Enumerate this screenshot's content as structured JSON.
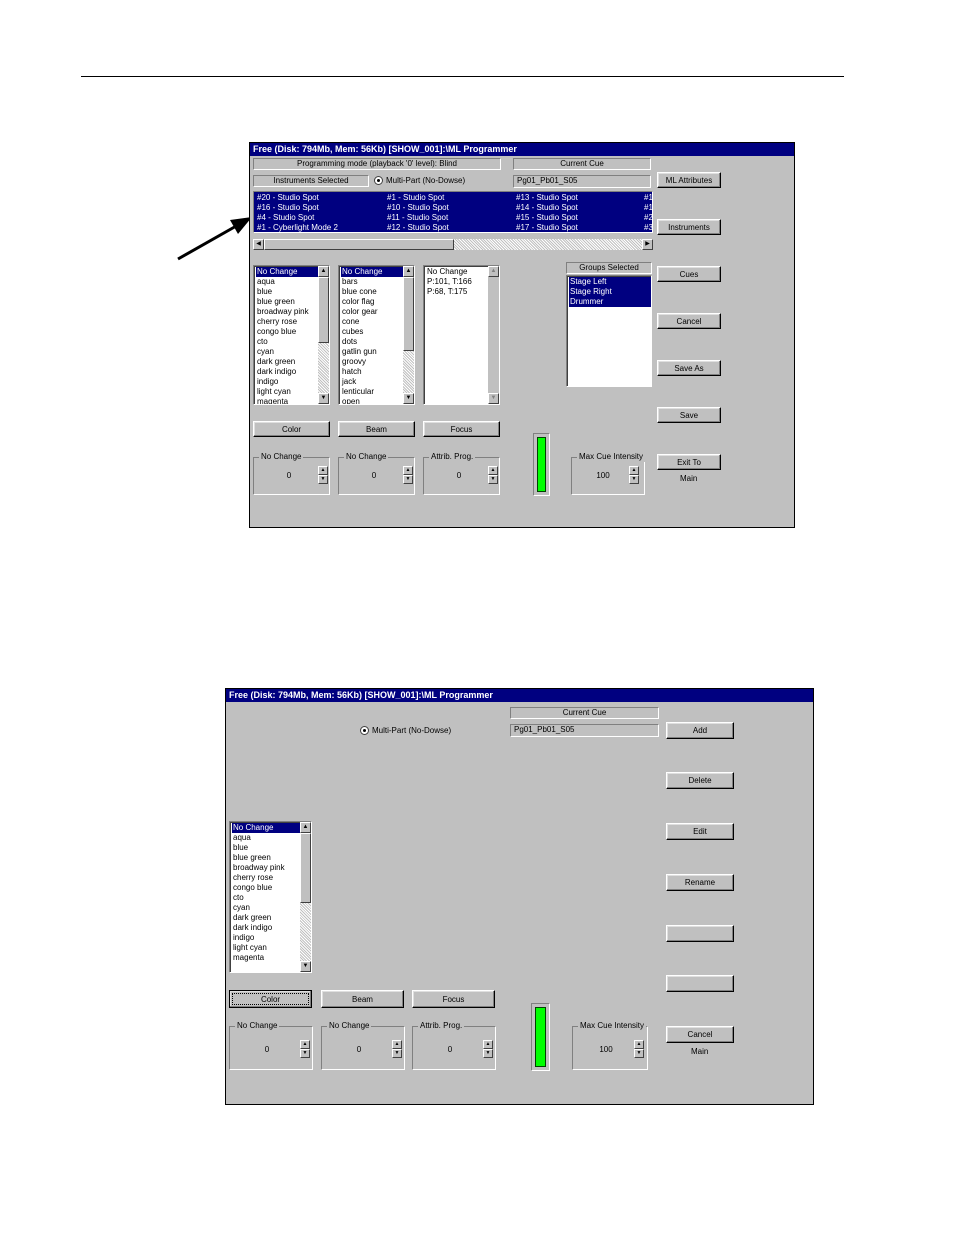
{
  "colors": {
    "titlebar": "#000080",
    "window": "#c0c0c0",
    "selection": "#000080",
    "meter": "#00ff00"
  },
  "window1": {
    "title": "Free (Disk: 794Mb, Mem: 56Kb)    [SHOW_001]:\\ML Programmer",
    "mode_label": "Programming mode (playback '0' level): Blind",
    "current_cue_label": "Current Cue",
    "current_cue_value": "Pg01_Pb01_S05",
    "instruments_selected_label": "Instruments Selected",
    "multipart_label": "Multi-Part (No-Dowse)",
    "instruments": [
      [
        "#20 - Studio Spot",
        "#16 - Studio Spot",
        "#4 - Studio Spot",
        "#1 - Cyberlight Mode 2"
      ],
      [
        "#1 - Studio Spot",
        "#10 - Studio Spot",
        "#11 - Studio Spot",
        "#12 - Studio Spot"
      ],
      [
        "#13 - Studio Spot",
        "#14 - Studio Spot",
        "#15 - Studio Spot",
        "#17 - Studio Spot"
      ],
      [
        "#1",
        "#1",
        "#2",
        "#3"
      ]
    ],
    "color_list": [
      "No Change",
      "aqua",
      "blue",
      "blue green",
      "broadway pink",
      "cherry rose",
      "congo blue",
      "cto",
      "cyan",
      "dark green",
      "dark indigo",
      "indigo",
      "light cyan",
      "magenta"
    ],
    "beam_list": [
      "No Change",
      "bars",
      "blue cone",
      "color flag",
      "color gear",
      "cone",
      "cubes",
      "dots",
      "gatlin gun",
      "groovy",
      "hatch",
      "jack",
      "lenticular",
      "open"
    ],
    "focus_list": [
      "No Change",
      "P:101, T:166",
      "P:68, T:175"
    ],
    "groups_selected_label": "Groups Selected",
    "groups": [
      "Stage Left",
      "Stage Right",
      "Drummer"
    ],
    "buttons": {
      "ml_attributes": "ML Attributes",
      "instruments": "Instruments",
      "cues": "Cues",
      "cancel": "Cancel",
      "save_as": "Save As",
      "save": "Save",
      "exit_to": "Exit To"
    },
    "exit_to_sub": "Main",
    "tab_buttons": [
      "Color",
      "Beam",
      "Focus"
    ],
    "spinners": [
      {
        "title": "No Change",
        "value": "0"
      },
      {
        "title": "No Change",
        "value": "0"
      },
      {
        "title": "Attrib. Prog.",
        "value": "0"
      }
    ],
    "max_cue": {
      "title": "Max Cue Intensity",
      "value": "100"
    }
  },
  "window2": {
    "title": "Free (Disk: 794Mb, Mem: 56Kb)    [SHOW_001]:\\ML Programmer",
    "current_cue_label": "Current Cue",
    "current_cue_value": "Pg01_Pb01_S05",
    "multipart_label": "Multi-Part (No-Dowse)",
    "color_list": [
      "No Change",
      "aqua",
      "blue",
      "blue green",
      "broadway pink",
      "cherry rose",
      "congo blue",
      "cto",
      "cyan",
      "dark green",
      "dark indigo",
      "indigo",
      "light cyan",
      "magenta"
    ],
    "buttons": {
      "add": "Add",
      "delete": "Delete",
      "edit": "Edit",
      "rename": "Rename",
      "blank1": "",
      "blank2": "",
      "cancel": "Cancel"
    },
    "cancel_sub": "Main",
    "tab_buttons": [
      "Color",
      "Beam",
      "Focus"
    ],
    "spinners": [
      {
        "title": "No Change",
        "value": "0"
      },
      {
        "title": "No Change",
        "value": "0"
      },
      {
        "title": "Attrib. Prog.",
        "value": "0"
      }
    ],
    "max_cue": {
      "title": "Max Cue Intensity",
      "value": "100"
    }
  }
}
